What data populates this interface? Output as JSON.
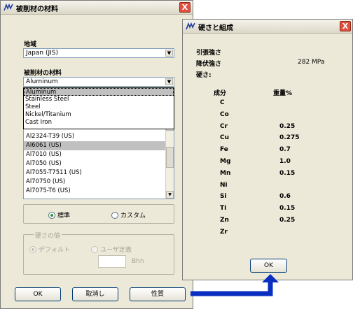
{
  "main": {
    "title": "被削材の材料",
    "close": "X",
    "region_label": "地域",
    "region_value": "Japan (JIS)",
    "material_label": "被削材の材料",
    "material_value": "Aluminum",
    "dropdown_items": [
      "Aluminum",
      "Stainless Steel",
      "Steel",
      "Nickel/Titanium",
      "Cast Iron"
    ],
    "grades": [
      "Al2324-T39 (US)",
      "Al6061 (US)",
      "Al7010 (US)",
      "Al7050 (US)",
      "Al7055-T7511 (US)",
      "Al70750 (US)",
      "Al7075-T6 (US)"
    ],
    "grades_selected_index": 1,
    "grade_partial": "(US)",
    "mode_standard": "標準",
    "mode_custom": "カスタム",
    "hardness_group": "硬さの値",
    "hardness_default": "デフォルト",
    "hardness_user": "ユーザ定義",
    "hardness_unit": "Bhn",
    "hardness_value": "",
    "ok_label": "OK",
    "cancel_label": "取消し",
    "properties_label": "性質"
  },
  "props": {
    "title": "硬さと組成",
    "close": "X",
    "tensile_label": "引張強さ",
    "yield_label": "降伏強さ",
    "yield_value": "282 MPa",
    "hardness_label": "硬さ:",
    "col_component": "成分",
    "col_weight": "重量%",
    "composition": [
      {
        "el": "C",
        "val": ""
      },
      {
        "el": "Co",
        "val": ""
      },
      {
        "el": "Cr",
        "val": "0.25"
      },
      {
        "el": "Cu",
        "val": "0.275"
      },
      {
        "el": "Fe",
        "val": "0.7"
      },
      {
        "el": "Mg",
        "val": "1.0"
      },
      {
        "el": "Mn",
        "val": "0.15"
      },
      {
        "el": "Ni",
        "val": ""
      },
      {
        "el": "Si",
        "val": "0.6"
      },
      {
        "el": "Ti",
        "val": "0.15"
      },
      {
        "el": "Zn",
        "val": "0.25"
      },
      {
        "el": "Zr",
        "val": ""
      }
    ],
    "ok_label": "OK"
  },
  "colors": {
    "arrow": "#0a2fc0",
    "close_red": "#e14f3e",
    "window_bg": "#ece9d8"
  }
}
